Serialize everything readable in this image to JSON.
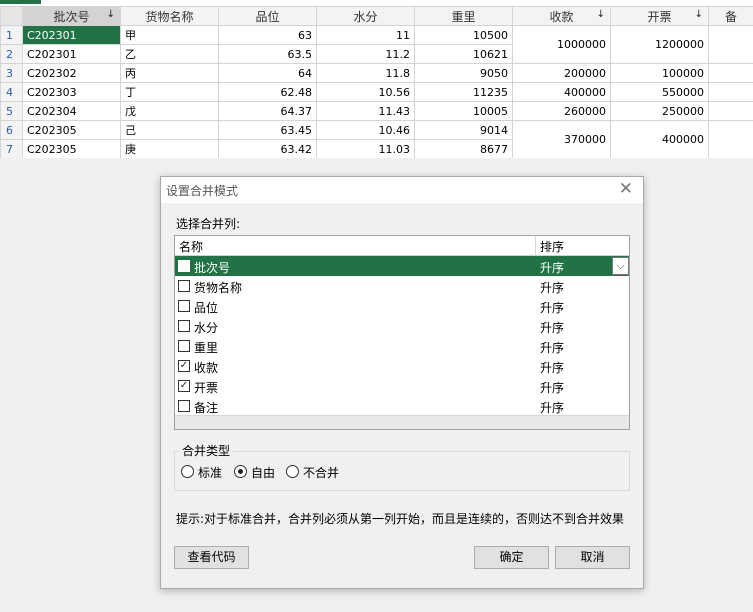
{
  "grid": {
    "headers": [
      {
        "label": "批次号",
        "sort": "↓"
      },
      {
        "label": "货物名称",
        "sort": ""
      },
      {
        "label": "品位",
        "sort": ""
      },
      {
        "label": "水分",
        "sort": ""
      },
      {
        "label": "重里",
        "sort": ""
      },
      {
        "label": "收款",
        "sort": "↓"
      },
      {
        "label": "开票",
        "sort": "↓"
      },
      {
        "label": "备",
        "sort": ""
      }
    ],
    "rows": [
      {
        "n": "1",
        "batch": "C202301",
        "goods": "甲",
        "grade": "63",
        "water": "11",
        "weight": "10500"
      },
      {
        "n": "2",
        "batch": "C202301",
        "goods": "乙",
        "grade": "63.5",
        "water": "11.2",
        "weight": "10621"
      },
      {
        "n": "3",
        "batch": "C202302",
        "goods": "丙",
        "grade": "64",
        "water": "11.8",
        "weight": "9050"
      },
      {
        "n": "4",
        "batch": "C202303",
        "goods": "丁",
        "grade": "62.48",
        "water": "10.56",
        "weight": "11235"
      },
      {
        "n": "5",
        "batch": "C202304",
        "goods": "戊",
        "grade": "64.37",
        "water": "11.43",
        "weight": "10005"
      },
      {
        "n": "6",
        "batch": "C202305",
        "goods": "己",
        "grade": "63.45",
        "water": "10.46",
        "weight": "9014"
      },
      {
        "n": "7",
        "batch": "C202305",
        "goods": "庚",
        "grade": "63.42",
        "water": "11.03",
        "weight": "8677"
      }
    ],
    "merged": {
      "pay_1": "1000000",
      "inv_1": "1200000",
      "pay_3": "200000",
      "inv_3": "100000",
      "pay_4": "400000",
      "inv_4": "550000",
      "pay_5": "260000",
      "inv_5": "250000",
      "pay_6": "370000",
      "inv_6": "400000"
    }
  },
  "dialog": {
    "title": "设置合并模式",
    "choose_label": "选择合并列:",
    "col_name": "名称",
    "col_order": "排序",
    "items": [
      {
        "name": "批次号",
        "order": "升序",
        "checked": false,
        "selected": true
      },
      {
        "name": "货物名称",
        "order": "升序",
        "checked": false
      },
      {
        "name": "品位",
        "order": "升序",
        "checked": false
      },
      {
        "name": "水分",
        "order": "升序",
        "checked": false
      },
      {
        "name": "重里",
        "order": "升序",
        "checked": false
      },
      {
        "name": "收款",
        "order": "升序",
        "checked": true
      },
      {
        "name": "开票",
        "order": "升序",
        "checked": true
      },
      {
        "name": "备注",
        "order": "升序",
        "checked": false
      }
    ],
    "merge_type_label": "合并类型",
    "radios": [
      {
        "label": "标准",
        "checked": false
      },
      {
        "label": "自由",
        "checked": true
      },
      {
        "label": "不合并",
        "checked": false
      }
    ],
    "hint": "提示:对于标准合并，合并列必须从第一列开始，而且是连续的，否则达不到合并效果",
    "btn_code": "查看代码",
    "btn_ok": "确定",
    "btn_cancel": "取消"
  },
  "colors": {
    "accent": "#217346"
  }
}
